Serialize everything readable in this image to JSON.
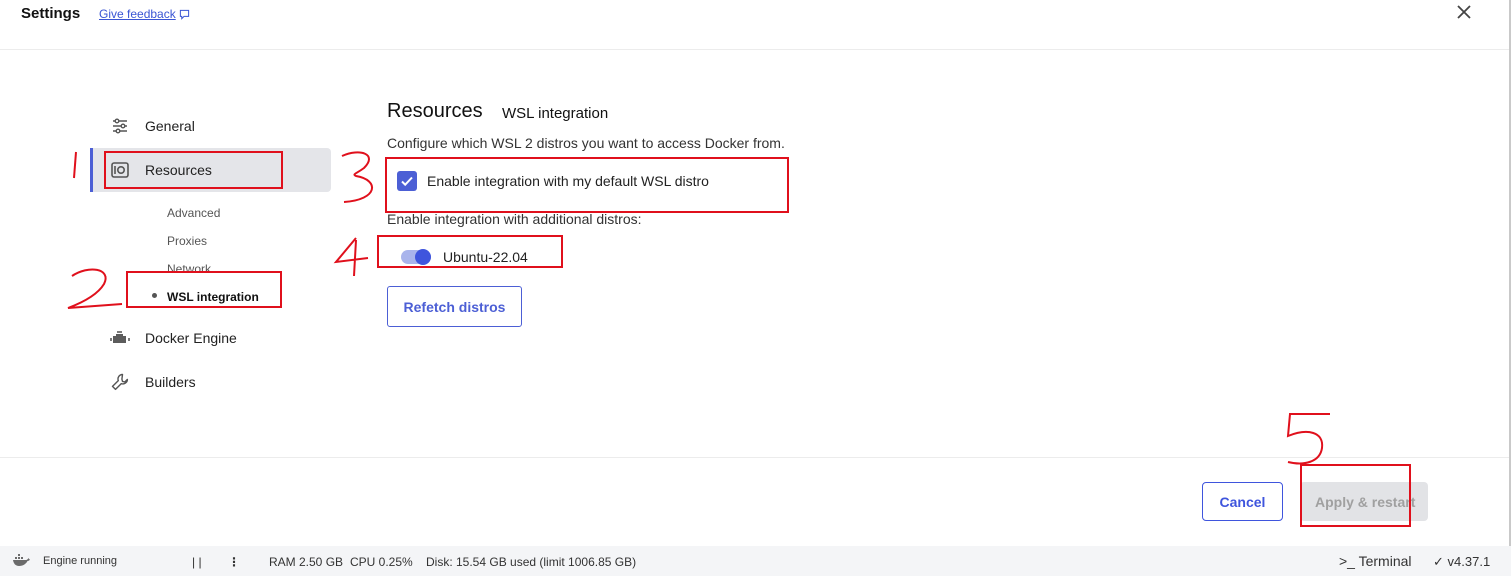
{
  "header": {
    "title": "Settings",
    "feedback_label": "Give feedback",
    "close_label": "✕"
  },
  "sidebar": {
    "items": [
      {
        "label": "General",
        "icon": "sliders-icon"
      },
      {
        "label": "Resources",
        "icon": "resources-icon"
      },
      {
        "label": "Docker Engine",
        "icon": "engine-icon"
      },
      {
        "label": "Builders",
        "icon": "wrench-icon"
      }
    ],
    "sub_items": [
      {
        "label": "Advanced"
      },
      {
        "label": "Proxies"
      },
      {
        "label": "Network"
      },
      {
        "label": "WSL integration"
      }
    ]
  },
  "main": {
    "heading": "Resources",
    "subheading": "WSL integration",
    "description": "Configure which WSL 2 distros you want to access Docker from.",
    "default_distro_label": "Enable integration with my default WSL distro",
    "default_distro_checked": true,
    "additional_label": "Enable integration with additional distros:",
    "distros": [
      {
        "label": "Ubuntu-22.04",
        "enabled": true
      }
    ],
    "refetch_label": "Refetch distros"
  },
  "footer": {
    "cancel_label": "Cancel",
    "apply_label": "Apply & restart"
  },
  "statusbar": {
    "engine_status": "Engine running",
    "pause_glyph": "| |",
    "menu_glyph": "⋮",
    "ram": "RAM 2.50 GB",
    "cpu": "CPU 0.25%",
    "disk": "Disk: 15.54 GB used (limit 1006.85 GB)",
    "terminal_label": "Terminal",
    "terminal_glyph": ">_",
    "version": "v4.37.1",
    "version_glyph": "✓"
  },
  "annotations": [
    "1",
    "2",
    "3",
    "4",
    "5"
  ],
  "colors": {
    "accent": "#4c5fd5",
    "annotation": "#e0101c"
  }
}
